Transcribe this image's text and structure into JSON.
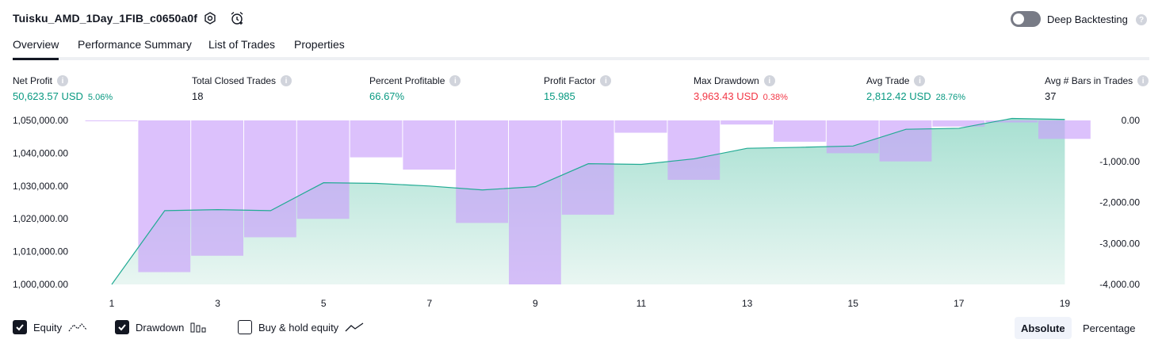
{
  "header": {
    "title": "Tuisku_AMD_1Day_1FIB_c0650a0f",
    "deep_backtesting_label": "Deep Backtesting",
    "deep_backtesting_enabled": false
  },
  "tabs": [
    {
      "label": "Overview",
      "active": true
    },
    {
      "label": "Performance Summary",
      "active": false
    },
    {
      "label": "List of Trades",
      "active": false
    },
    {
      "label": "Properties",
      "active": false
    }
  ],
  "metrics": [
    {
      "label": "Net Profit",
      "value": "50,623.57 USD",
      "pct": "5.06%",
      "color": "green"
    },
    {
      "label": "Total Closed Trades",
      "value": "18",
      "pct": "",
      "color": "default"
    },
    {
      "label": "Percent Profitable",
      "value": "66.67%",
      "pct": "",
      "color": "green"
    },
    {
      "label": "Profit Factor",
      "value": "15.985",
      "pct": "",
      "color": "green"
    },
    {
      "label": "Max Drawdown",
      "value": "3,963.43 USD",
      "pct": "0.38%",
      "color": "red"
    },
    {
      "label": "Avg Trade",
      "value": "2,812.42 USD",
      "pct": "28.76%",
      "color": "green"
    },
    {
      "label": "Avg # Bars in Trades",
      "value": "37",
      "pct": "",
      "color": "default"
    }
  ],
  "chart_data": {
    "type": "area",
    "left_axis_ticks": [
      "1,050,000.00",
      "1,040,000.00",
      "1,030,000.00",
      "1,020,000.00",
      "1,010,000.00",
      "1,000,000.00"
    ],
    "right_axis_ticks": [
      "0.00",
      "-1,000.00",
      "-2,000.00",
      "-3,000.00",
      "-4,000.00"
    ],
    "x_ticks": [
      "1",
      "3",
      "5",
      "7",
      "9",
      "11",
      "13",
      "15",
      "17",
      "19"
    ],
    "left_ylim": [
      1000000,
      1050000
    ],
    "right_ylim": [
      -4000,
      0
    ],
    "x": [
      1,
      2,
      3,
      4,
      5,
      6,
      7,
      8,
      9,
      10,
      11,
      12,
      13,
      14,
      15,
      16,
      17,
      18,
      19
    ],
    "series": [
      {
        "type": "area",
        "values": [
          1000000,
          1022500,
          1022800,
          1022500,
          1031000,
          1030800,
          1030000,
          1028800,
          1029800,
          1036800,
          1036600,
          1038300,
          1041500,
          1041800,
          1042200,
          1047300,
          1047600,
          1050600,
          1050300
        ],
        "color": "#22ab94"
      },
      {
        "type": "bar",
        "values": [
          -20,
          -3700,
          -3300,
          -2850,
          -2400,
          -900,
          -1200,
          -2500,
          -4000,
          -2300,
          -300,
          -1450,
          -100,
          -520,
          -800,
          -1000,
          -150,
          -50,
          -450
        ],
        "color": "#c9a0fb"
      }
    ]
  },
  "legend": [
    {
      "label": "Equity",
      "checked": true,
      "icon": "equity-icon"
    },
    {
      "label": "Drawdown",
      "checked": true,
      "icon": "drawdown-icon"
    },
    {
      "label": "Buy & hold equity",
      "checked": false,
      "icon": "buy-hold-icon"
    }
  ],
  "modes": [
    {
      "label": "Absolute",
      "active": true
    },
    {
      "label": "Percentage",
      "active": false
    }
  ]
}
